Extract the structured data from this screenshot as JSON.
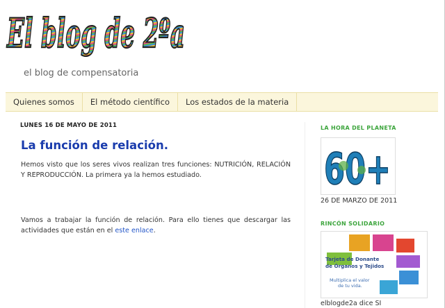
{
  "blog": {
    "logo_text": "El blog de 2ºa",
    "tagline": "el blog de compensatoria"
  },
  "nav": {
    "tabs": [
      {
        "label": "Quienes somos"
      },
      {
        "label": "El método científico"
      },
      {
        "label": "Los estados de la materia"
      }
    ]
  },
  "post": {
    "date": "LUNES 16 DE MAYO DE 2011",
    "title": "La función de relación.",
    "para1": "Hemos visto que los seres vivos realizan tres funciones: NUTRICIÓN, RELACIÓN Y REPRODUCCIÓN. La primera ya la hemos estudiado.",
    "para2_text": "Vamos a trabajar la función de relación. Para ello tienes que descargar las actividades que están en el ",
    "para2_link": "este enlace",
    "para2_end": "."
  },
  "sidebar": {
    "earth_hour_title": "LA HORA DEL PLANETA",
    "earth_hour_badge": "60+",
    "earth_hour_date": "26 DE MARZO DE 2011",
    "solidarity_title": "RINCÓN SOLIDARIO",
    "donor_card_line1": "Tarjeta de Donante",
    "donor_card_line2": "de Órganos y Tejidos",
    "donor_card_line3": "Multiplica el valor",
    "donor_card_line4": "de tu vida.",
    "donor_caption": "elblogde2a dice SI"
  },
  "colors": {
    "title": "#1a3cad",
    "sidebar_heading": "#3da53d",
    "nav_bg": "#fbf6dc",
    "link": "#2356c8"
  }
}
